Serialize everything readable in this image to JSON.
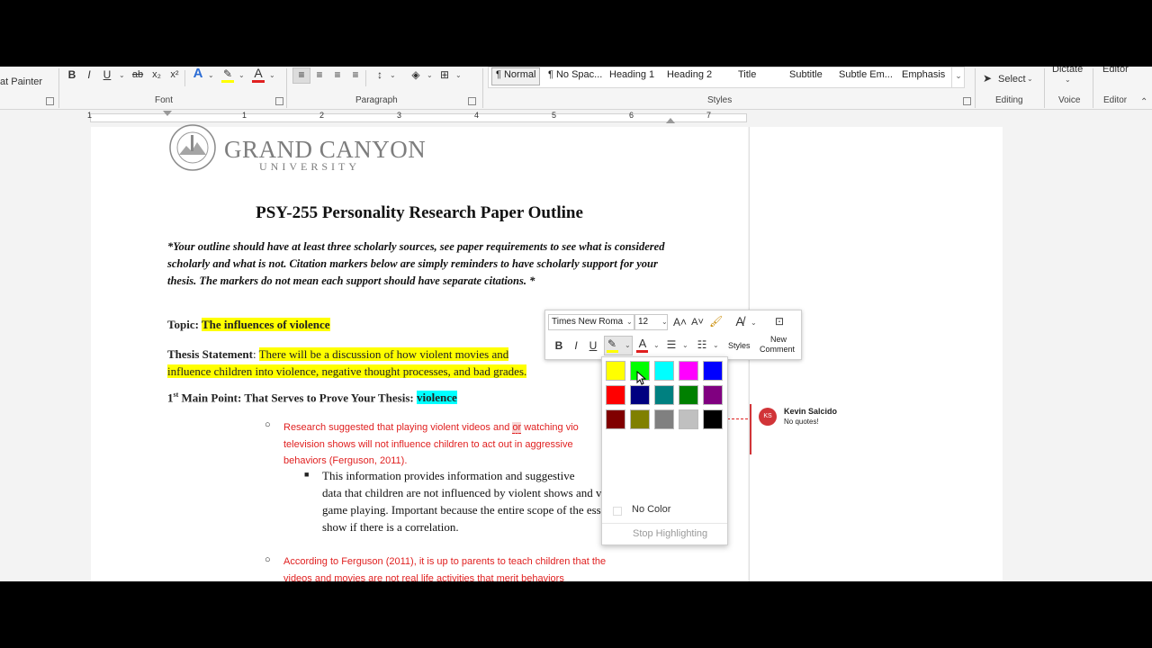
{
  "ribbon": {
    "format_painter": "at Painter",
    "groups": {
      "font": "Font",
      "paragraph": "Paragraph",
      "styles": "Styles",
      "editing": "Editing",
      "voice": "Voice",
      "editor": "Editor"
    },
    "styles": [
      "¶ Normal",
      "¶ No Spac...",
      "Heading 1",
      "Heading 2",
      "Title",
      "Subtitle",
      "Subtle Em...",
      "Emphasis"
    ],
    "select_label": "Select",
    "dictate_label": "Dictate",
    "editor_label": "Editor",
    "font_buttons": {
      "bold": "B",
      "italic": "I",
      "underline": "U"
    },
    "font_color": "#e02020",
    "highlight_color": "#ffff00"
  },
  "ruler": {
    "numbers": [
      "1",
      "1",
      "2",
      "3",
      "4",
      "5",
      "6",
      "7"
    ]
  },
  "document": {
    "logo": {
      "name": "GRAND CANYON",
      "sub": "UNIVERSITY",
      "seal_text": "GRAND CANYON UNIVERSITY ARIZONA 1949"
    },
    "title": "PSY-255 Personality Research Paper Outline",
    "instructions": "*Your outline should have at least three scholarly sources, see paper requirements to see what is considered scholarly and what is not. Citation markers below are simply reminders to have scholarly support for your thesis. The markers do not mean each support should have separate citations. *",
    "topic_label": "Topic:",
    "topic_value": "The influences of violence",
    "thesis_label": "Thesis Statement",
    "thesis_line1": "There will be a discussion of how violent movies and",
    "thesis_line2": "influence children into violence, negative thought processes, and bad grades.",
    "main_point_num": "1",
    "main_point_sup": "st",
    "main_point_label": " Main Point: That Serves to Prove Your Thesis: ",
    "main_point_value": "violence",
    "b1_line1a": "Research suggested that playing violent videos and ",
    "b1_line1b": "or",
    "b1_line1c": " watching vio",
    "b1_line2": "television shows will not influence children to act out in aggressive",
    "b1_line3": "behaviors (Ferguson, 2011).",
    "sub_line1": "This information provides information and suggestive",
    "sub_line2": "data that children are not influenced by violent shows and video",
    "sub_line3": "game playing. Important because the entire scope of the essay is to",
    "sub_line4": "show if there is a correlation.",
    "b2_line1": "According to Ferguson (2011), it is up to parents to teach children that the",
    "b2_line2": "videos and movies are not real life activities that merit behaviors"
  },
  "comment": {
    "initials": "KS",
    "author": "Kevin Salcido",
    "text": "No quotes!",
    "color": "#d13438"
  },
  "mini_toolbar": {
    "font_name": "Times New Roma",
    "font_size": "12",
    "bold": "B",
    "italic": "I",
    "underline": "U",
    "styles_label": "Styles",
    "new_comment_line1": "New",
    "new_comment_line2": "Comment"
  },
  "highlight_palette": {
    "colors": [
      [
        "#ffff00",
        "#00ff00",
        "#00ffff",
        "#ff00ff",
        "#0000ff"
      ],
      [
        "#ff0000",
        "#000080",
        "#008080",
        "#008000",
        "#800080"
      ],
      [
        "#800000",
        "#808000",
        "#808080",
        "#c0c0c0",
        "#000000"
      ]
    ],
    "no_color": "No Color",
    "stop": "Stop Highlighting"
  }
}
